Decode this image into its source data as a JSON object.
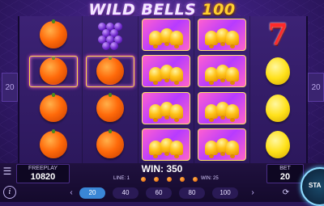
{
  "game": {
    "title_main": "WILD BELLS",
    "title_number": "100"
  },
  "reels": [
    [
      "orange",
      "orange",
      "orange",
      "orange"
    ],
    [
      "grapes",
      "orange",
      "orange",
      "orange"
    ],
    [
      "bells",
      "bells",
      "bells",
      "bells"
    ],
    [
      "bells",
      "bells",
      "bells",
      "bells"
    ],
    [
      "seven",
      "lemon",
      "lemon",
      "lemon"
    ]
  ],
  "highlighted_row": 1,
  "side_lines": {
    "left": "20",
    "right": "20"
  },
  "freeplay": {
    "label": "FREEPLAY",
    "value": "10820"
  },
  "bet": {
    "label": "BET",
    "value": "20"
  },
  "win": {
    "text": "WIN: 350"
  },
  "lines_info": {
    "line_label": "LINE: 1",
    "win_label": "WIN: 25"
  },
  "bet_options": [
    "20",
    "40",
    "60",
    "80",
    "100"
  ],
  "selected_bet": "20",
  "controls": {
    "spin_label": "STA",
    "menu_icon": "menu-icon",
    "info_icon": "info-icon"
  },
  "colors": {
    "accent": "#3a86d6",
    "frame": "#ffd84a",
    "spin_ring": "#8fdcff"
  }
}
